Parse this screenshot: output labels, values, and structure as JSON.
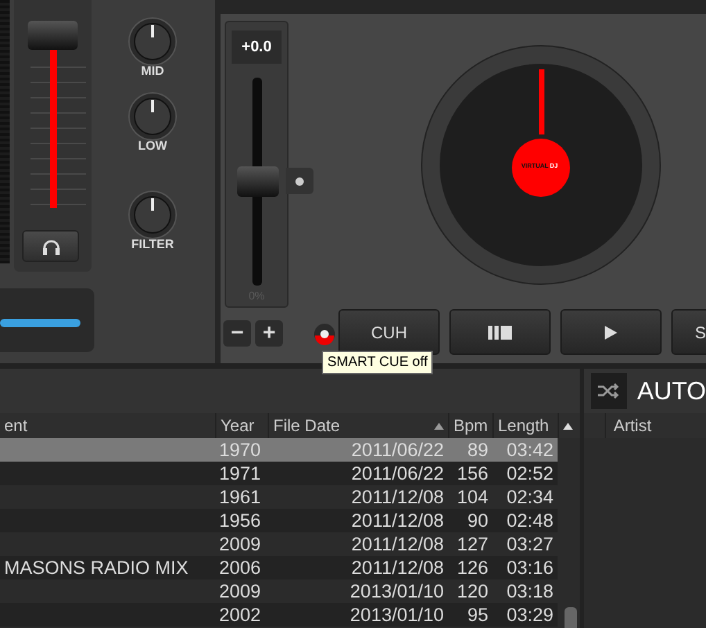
{
  "mixer": {
    "knobs": [
      {
        "label": "MID"
      },
      {
        "label": "LOW"
      },
      {
        "label": "FILTER"
      }
    ],
    "crossfader": {
      "level": 0.85
    }
  },
  "deck": {
    "pitch": {
      "reading": "+0.0",
      "scale": "0%",
      "level": 0.5
    },
    "pitch_buttons": [
      "−",
      "+"
    ],
    "smart_cue": {
      "on": false
    },
    "transport": [
      {
        "kind": "text",
        "label": "CUH"
      },
      {
        "kind": "pause-stop"
      },
      {
        "kind": "play"
      },
      {
        "kind": "text",
        "label": "S"
      }
    ],
    "turntable": {
      "logo": [
        "VIRTUAL",
        "DJ"
      ]
    }
  },
  "tooltip": "SMART CUE off",
  "browser": {
    "columns": [
      {
        "label": "ent",
        "sorted": false
      },
      {
        "label": "Year",
        "sorted": false
      },
      {
        "label": "File Date",
        "sorted": true
      },
      {
        "label": "Bpm",
        "sorted": false
      },
      {
        "label": "Length",
        "sorted": false
      }
    ],
    "rows": [
      {
        "year": "1970",
        "file_date": "2011/06/22",
        "bpm": "89",
        "length": "03:42",
        "selected": true
      },
      {
        "year": "1971",
        "file_date": "2011/06/22",
        "bpm": "156",
        "length": "02:52",
        "selected": false
      },
      {
        "year": "1961",
        "file_date": "2011/12/08",
        "bpm": "104",
        "length": "02:34",
        "selected": false
      },
      {
        "year": "1956",
        "file_date": "2011/12/08",
        "bpm": "90",
        "length": "02:48",
        "selected": false
      },
      {
        "year": "2009",
        "file_date": "2011/12/08",
        "bpm": "127",
        "length": "03:27",
        "selected": false
      },
      {
        "title": "MASONS RADIO MIX",
        "year": "2006",
        "file_date": "2011/12/08",
        "bpm": "126",
        "length": "03:16",
        "selected": false
      },
      {
        "year": "2009",
        "file_date": "2013/01/10",
        "bpm": "120",
        "length": "03:18",
        "selected": false
      },
      {
        "year": "2002",
        "file_date": "2013/01/10",
        "bpm": "95",
        "length": "03:29",
        "selected": false
      }
    ]
  },
  "automix": {
    "title": "AUTO",
    "columns": [
      "Artist"
    ]
  }
}
